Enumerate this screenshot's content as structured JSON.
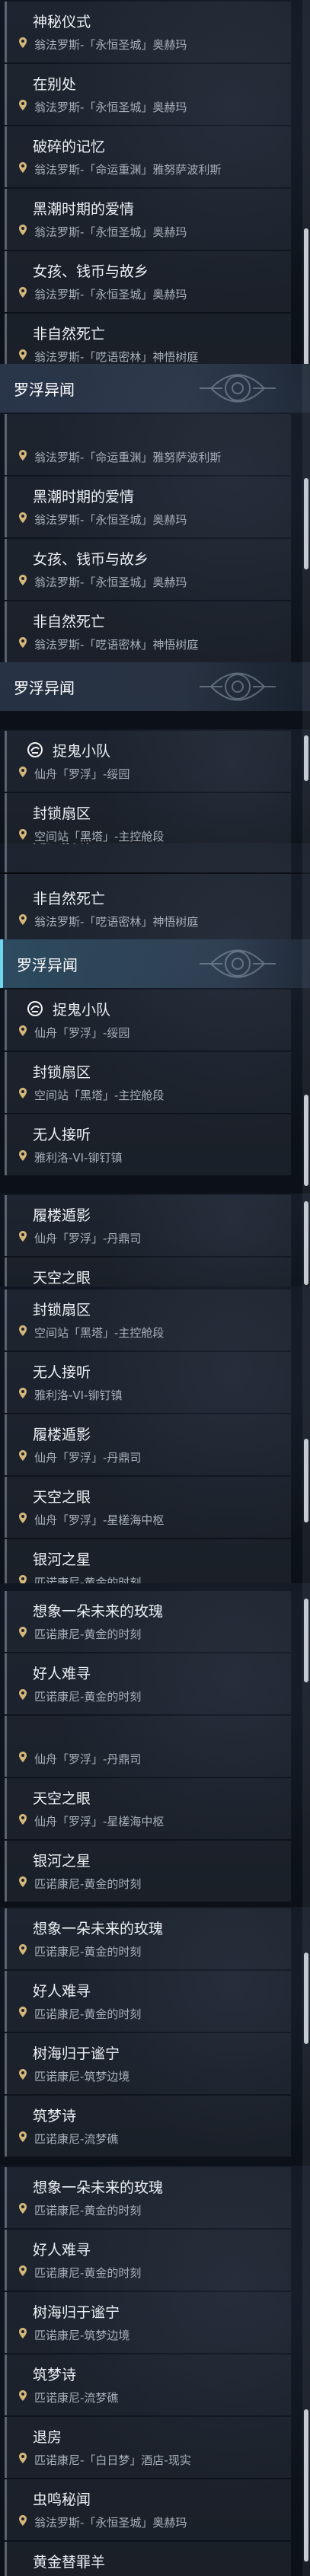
{
  "locations": {
    "yongheng": "翁法罗斯-「永恒圣城」奥赫玛",
    "mingyun": "翁法罗斯-「命运重渊」雅努萨波利斯",
    "yiwang": "翁法罗斯-「呓语密林」神悟树庭",
    "xianzhou_jingan": "仙舟「罗浮」-绥园",
    "heita": "空间站「黑塔」-主控舱段",
    "yali": "雅利洛-VI-铆钉镇",
    "dingxi": "仙舟「罗浮」-丹鼎司",
    "xinghai": "仙舟「罗浮」-星槎海中枢",
    "penacony_gold": "匹诺康尼-黄金的时刻",
    "penacony_zhumeng": "匹诺康尼-筑梦边境",
    "penacony_liumeng": "匹诺康尼-流梦礁",
    "penacony_baiqi": "匹诺康尼-「白日梦」酒店-现实"
  },
  "titles": {
    "shenmi": "神秘仪式",
    "zaibie": "在别处",
    "posui": "破碎的记忆",
    "heichao": "黑潮时期的爱情",
    "nvhai": "女孩、钱币与故乡",
    "feiziran": "非自然死亡",
    "zhuogui": "捉鬼小队",
    "fengsuo": "封锁扇区",
    "wuren": "无人接听",
    "lvji": "履楼遁影",
    "tianyan": "天空之眼",
    "yinhe": "银河之星",
    "xiangxiang": "想象一朵未来的玫瑰",
    "haoren": "好人难寻",
    "shuhai": "树海归于谧宁",
    "zhumeng": "筑梦诗",
    "tuifang": "退房",
    "chongming": "虫鸣秘闻",
    "huangjin": "黄金替罪羊"
  },
  "section": {
    "luofu": "罗浮异闻"
  }
}
